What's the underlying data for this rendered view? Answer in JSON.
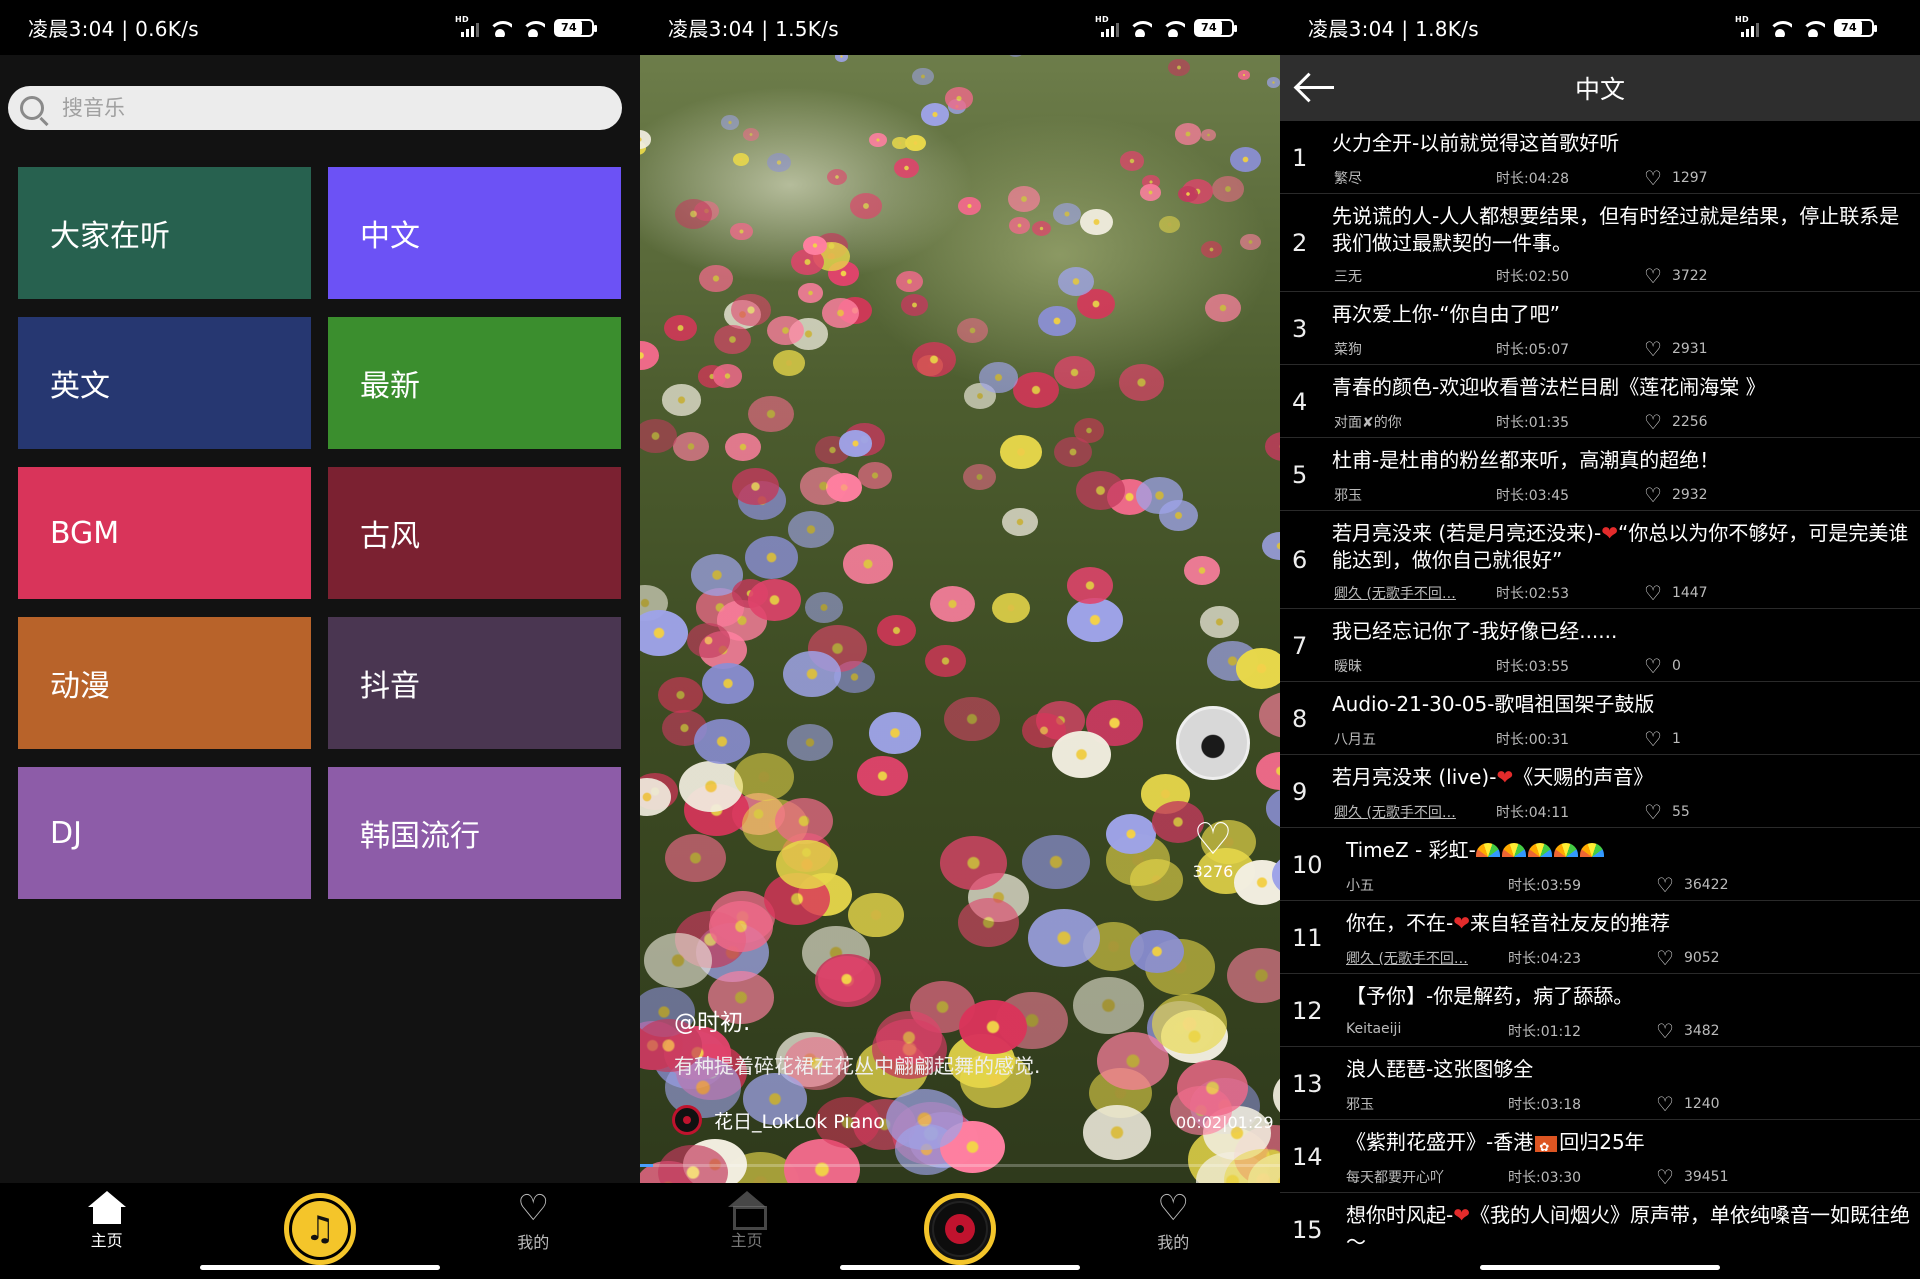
{
  "status_bars": [
    {
      "text": "凌晨3:04 | 0.6K/s",
      "battery": "74"
    },
    {
      "text": "凌晨3:04 | 1.5K/s",
      "battery": "74"
    },
    {
      "text": "凌晨3:04 | 1.8K/s",
      "battery": "74"
    }
  ],
  "home": {
    "search_placeholder": "搜音乐",
    "categories": [
      {
        "label": "大家在听",
        "color": "#27614f"
      },
      {
        "label": "中文",
        "color": "#6c52f5"
      },
      {
        "label": "英文",
        "color": "#263771"
      },
      {
        "label": "最新",
        "color": "#3b8e2e"
      },
      {
        "label": "BGM",
        "color": "#d9345a"
      },
      {
        "label": "古风",
        "color": "#7b2131"
      },
      {
        "label": "动漫",
        "color": "#b8632a"
      },
      {
        "label": "抖音",
        "color": "#4a3651"
      },
      {
        "label": "DJ",
        "color": "#8d5ca8"
      },
      {
        "label": "韩国流行",
        "color": "#8d5ca8"
      }
    ]
  },
  "nav": {
    "home": "主页",
    "mine": "我的",
    "accent": "#f4c52a"
  },
  "player": {
    "author": "@时初.",
    "description": "有种提着碎花裙在花丛中翩翩起舞的感觉.",
    "music": "花日_LokLok Piano",
    "time": "00:02|01:29",
    "likes": "3276",
    "progress": 0.02
  },
  "list_page": {
    "title": "中文",
    "songs": [
      {
        "num": "1",
        "title": "火力全开-以前就觉得这首歌好听",
        "singer": "繁尽",
        "duration": "时长:04:28",
        "likes": "1297"
      },
      {
        "num": "2",
        "title": "先说谎的人-人人都想要结果，但有时经过就是结果，停止联系是我们做过最默契的一件事。",
        "singer": "三无",
        "duration": "时长:02:50",
        "likes": "3722"
      },
      {
        "num": "3",
        "title": "再次爱上你-“你自由了吧”",
        "singer": "菜狗",
        "duration": "时长:05:07",
        "likes": "2931"
      },
      {
        "num": "4",
        "title": "青春的颜色-欢迎收看普法栏目剧《莲花闹海棠 》",
        "singer": "对面✘的你",
        "duration": "时长:01:35",
        "likes": "2256"
      },
      {
        "num": "5",
        "title": "杜甫-是杜甫的粉丝都来听，高潮真的超绝！",
        "singer": "邪玉",
        "duration": "时长:03:45",
        "likes": "2932"
      },
      {
        "num": "6",
        "title": "若月亮没来 (若是月亮还没来)-❤“你总以为你不够好，可是完美谁能达到，做你自己就很好”",
        "singer": "卿久 (无歌手不回…",
        "duration": "时长:02:53",
        "likes": "1447"
      },
      {
        "num": "7",
        "title": "我已经忘记你了-我好像已经......",
        "singer": "暧昧",
        "duration": "时长:03:55",
        "likes": "0"
      },
      {
        "num": "8",
        "title": "Audio-21-30-05-歌唱祖国架子鼓版",
        "singer": "八月五",
        "duration": "时长:00:31",
        "likes": "1"
      },
      {
        "num": "9",
        "title": "若月亮没来 (live)-❤《天赐的声音》",
        "singer": "卿久 (无歌手不回…",
        "duration": "时长:04:11",
        "likes": "55"
      },
      {
        "num": "10",
        "title": "TimeZ - 彩虹-",
        "singer": "小五",
        "duration": "时长:03:59",
        "likes": "36422"
      },
      {
        "num": "11",
        "title": "你在，不在-❤来自轻音社友友的推荐",
        "singer": "卿久 (无歌手不回…",
        "duration": "时长:04:23",
        "likes": "9052"
      },
      {
        "num": "12",
        "title": "【予你】-你是解药，病了舔舔。",
        "singer": "Keitaeiji",
        "duration": "时长:01:12",
        "likes": "3482"
      },
      {
        "num": "13",
        "title": "浪人琵琶-这张图够全",
        "singer": "邪玉",
        "duration": "时长:03:18",
        "likes": "1240"
      },
      {
        "num": "14",
        "title": "《紫荆花盛开》-香港",
        "title_tail": "回归25年",
        "singer": "每天都要开心吖",
        "duration": "时长:03:30",
        "likes": "39451"
      },
      {
        "num": "15",
        "title": "想你时风起-❤《我的人间烟火》原声带，单依纯嗓音一如既往绝～",
        "singer": "",
        "duration": "",
        "likes": ""
      }
    ]
  }
}
